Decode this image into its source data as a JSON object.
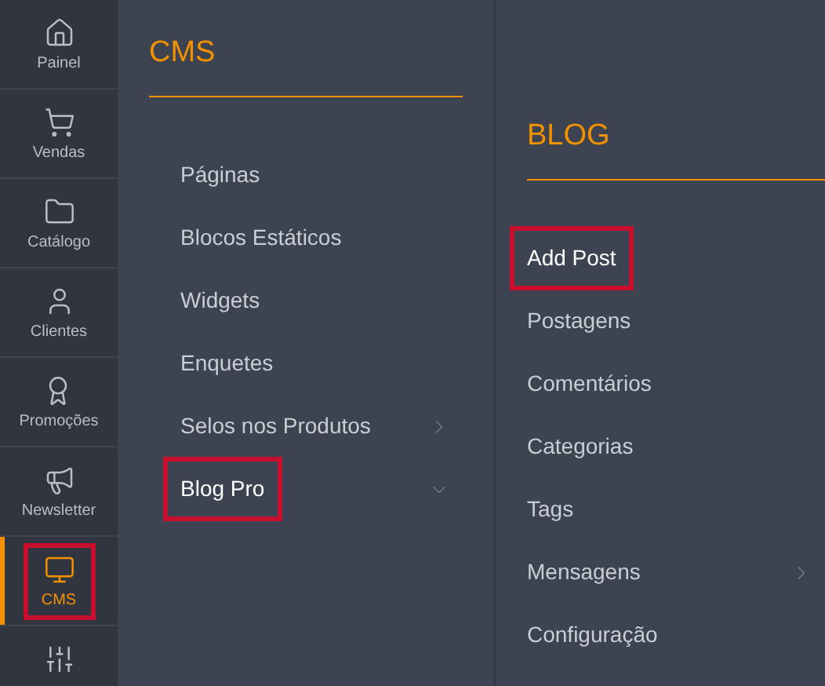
{
  "sidebar": {
    "items": [
      {
        "kind": "home",
        "label": "Painel",
        "selected": false,
        "highlighted": false
      },
      {
        "kind": "cart",
        "label": "Vendas",
        "selected": false,
        "highlighted": false
      },
      {
        "kind": "folder",
        "label": "Catálogo",
        "selected": false,
        "highlighted": false
      },
      {
        "kind": "person",
        "label": "Clientes",
        "selected": false,
        "highlighted": false
      },
      {
        "kind": "ribbon",
        "label": "Promoções",
        "selected": false,
        "highlighted": false
      },
      {
        "kind": "megaphone",
        "label": "Newsletter",
        "selected": false,
        "highlighted": false
      },
      {
        "kind": "monitor",
        "label": "CMS",
        "selected": true,
        "highlighted": true
      },
      {
        "kind": "sliders",
        "selected": false,
        "highlighted": false
      }
    ]
  },
  "cms_panel": {
    "title": "CMS",
    "items": [
      {
        "label": "Páginas",
        "has_submenu": false,
        "highlighted": false
      },
      {
        "label": "Blocos Estáticos",
        "has_submenu": false,
        "highlighted": false
      },
      {
        "label": "Widgets",
        "has_submenu": false,
        "highlighted": false
      },
      {
        "label": "Enquetes",
        "has_submenu": false,
        "highlighted": false
      },
      {
        "label": "Selos nos Produtos",
        "has_submenu": true,
        "expanded": false,
        "highlighted": false
      },
      {
        "label": "Blog Pro",
        "has_submenu": true,
        "expanded": true,
        "highlighted": true
      }
    ]
  },
  "blog_panel": {
    "title": "BLOG",
    "items": [
      {
        "label": "Add Post",
        "has_submenu": false,
        "highlighted": true
      },
      {
        "label": "Postagens",
        "has_submenu": false,
        "highlighted": false
      },
      {
        "label": "Comentários",
        "has_submenu": false,
        "highlighted": false
      },
      {
        "label": "Categorias",
        "has_submenu": false,
        "highlighted": false
      },
      {
        "label": "Tags",
        "has_submenu": false,
        "highlighted": false
      },
      {
        "label": "Mensagens",
        "has_submenu": true,
        "expanded": false,
        "highlighted": false
      },
      {
        "label": "Configuração",
        "has_submenu": false,
        "highlighted": false
      }
    ]
  }
}
